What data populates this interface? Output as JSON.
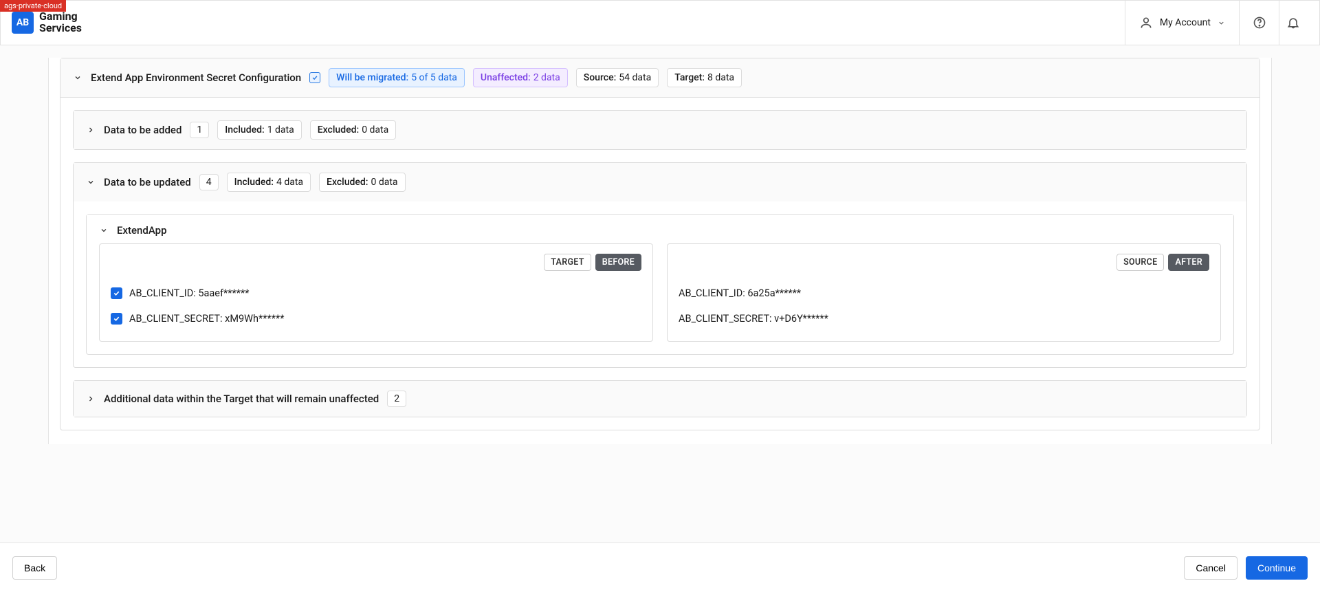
{
  "env_tag": "ags-private-cloud",
  "brand": {
    "logo_text": "AB",
    "line1": "Gaming",
    "line2": "Services"
  },
  "header": {
    "account_label": "My Account"
  },
  "section": {
    "title": "Extend App Environment Secret Configuration",
    "migrate": {
      "label": "Will be migrated:",
      "value": "5 of 5 data"
    },
    "unaffected": {
      "label": "Unaffected:",
      "value": "2 data"
    },
    "source": {
      "label": "Source:",
      "value": "54 data"
    },
    "target": {
      "label": "Target:",
      "value": "8 data"
    }
  },
  "added": {
    "title": "Data to be added",
    "count": "1",
    "included": {
      "label": "Included:",
      "value": "1 data"
    },
    "excluded": {
      "label": "Excluded:",
      "value": "0 data"
    }
  },
  "updated": {
    "title": "Data to be updated",
    "count": "4",
    "included": {
      "label": "Included:",
      "value": "4 data"
    },
    "excluded": {
      "label": "Excluded:",
      "value": "0 data"
    }
  },
  "app": {
    "name": "ExtendApp",
    "left": {
      "tag1": "TARGET",
      "tag2": "BEFORE",
      "rows": [
        "AB_CLIENT_ID: 5aaef******",
        "AB_CLIENT_SECRET: xM9Wh******"
      ]
    },
    "right": {
      "tag1": "SOURCE",
      "tag2": "AFTER",
      "rows": [
        "AB_CLIENT_ID: 6a25a******",
        "AB_CLIENT_SECRET: v+D6Y******"
      ]
    }
  },
  "additional": {
    "title": "Additional data within the Target that will remain unaffected",
    "count": "2"
  },
  "footer": {
    "back": "Back",
    "cancel": "Cancel",
    "continue": "Continue"
  }
}
